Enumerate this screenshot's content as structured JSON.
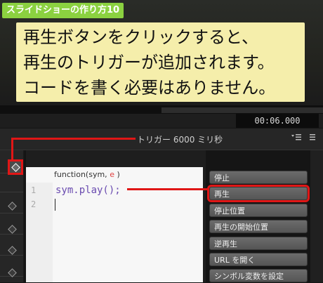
{
  "title_badge": "スライドショーの作り方10",
  "caption": {
    "line1": "再生ボタンをクリックすると、",
    "line2": "再生のトリガーが追加されます。",
    "line3": "コードを書く必要はありません。"
  },
  "timeline": {
    "time": "00:06.000"
  },
  "panel": {
    "title": "トリガー 6000 ミリ秒",
    "menu_icon": "panel-menu-icon",
    "close_icon": "close-icon"
  },
  "editor": {
    "function_prefix": "function(sym, ",
    "function_param": "e",
    "function_suffix": " )",
    "lines": [
      {
        "num": "1",
        "code": "sym.play();"
      },
      {
        "num": "2",
        "code": ""
      }
    ]
  },
  "snippets": [
    {
      "label": "停止",
      "highlighted": false
    },
    {
      "label": "再生",
      "highlighted": true
    },
    {
      "label": "停止位置",
      "highlighted": false
    },
    {
      "label": "再生の開始位置",
      "highlighted": false
    },
    {
      "label": "逆再生",
      "highlighted": false
    },
    {
      "label": "URL を開く",
      "highlighted": false
    },
    {
      "label": "シンボル変数を設定",
      "highlighted": false
    }
  ],
  "colors": {
    "highlight": "#e01616",
    "badge": "#8bd140",
    "caption_bg": "#f5eeab"
  }
}
